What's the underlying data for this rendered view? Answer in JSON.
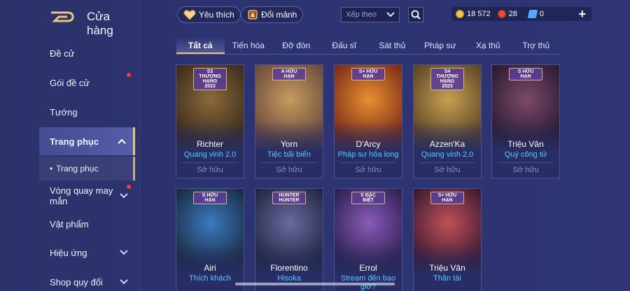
{
  "header": {
    "title": "Cửa hàng",
    "favorite_label": "Yêu thích",
    "exchange_label": "Đổi mảnh",
    "sort_label": "Xếp theo",
    "currencies": [
      {
        "icon": "gold-coin-icon",
        "value": "18 572",
        "color": "#f0c24a"
      },
      {
        "icon": "red-voucher-icon",
        "value": "28",
        "color": "#e0503a"
      },
      {
        "icon": "blue-ticket-icon",
        "value": "0",
        "color": "#5aa7ff"
      }
    ],
    "plus_label": "+"
  },
  "sidebar": {
    "items": [
      {
        "label": "Đề cử",
        "has_dot": false
      },
      {
        "label": "Gói đề cử",
        "has_dot": true
      },
      {
        "label": "Tướng",
        "has_dot": false
      },
      {
        "label": "Trang phục",
        "has_dot": false,
        "expanded": true
      },
      {
        "label": "Trang phục",
        "sub": true
      },
      {
        "label": "Vòng quay may mắn",
        "has_dot": true
      },
      {
        "label": "Vật phẩm",
        "has_dot": false
      },
      {
        "label": "Hiệu ứng",
        "has_dot": false
      },
      {
        "label": "Shop quy đổi",
        "has_dot": false
      }
    ]
  },
  "tabs": [
    "Tất cả",
    "Tiến hóa",
    "Đỡ đòn",
    "Đấu sĩ",
    "Sát thủ",
    "Pháp sư",
    "Xạ thủ",
    "Trợ thủ"
  ],
  "active_tab": 0,
  "cards": [
    {
      "hero": "Richter",
      "skin": "Quang vinh 2.0",
      "status": "Sở hữu",
      "badge": "S3 THƯỢNG HẠNG 2023",
      "c1": "#8a6a3a",
      "c2": "#3c2a1c"
    },
    {
      "hero": "Yorn",
      "skin": "Tiệc bãi biển",
      "status": "Sở hữu",
      "badge": "A HỮU HẠN",
      "c1": "#c69a60",
      "c2": "#6a4a3a"
    },
    {
      "hero": "D'Arcy",
      "skin": "Pháp sư hỏa long",
      "status": "Sở hữu",
      "badge": "S+ HỮU HẠN",
      "c1": "#e8902e",
      "c2": "#7a2a1a"
    },
    {
      "hero": "Azzen'Ka",
      "skin": "Quang vinh 2.0",
      "status": "Sở hữu",
      "badge": "S4 THƯỢNG HẠNG 2023",
      "c1": "#c8a050",
      "c2": "#5a4426"
    },
    {
      "hero": "Triệu Vân",
      "skin": "Quý công tử",
      "status": "Sở hữu",
      "badge": "S HỮU HẠN",
      "c1": "#7a4a6a",
      "c2": "#2a1a30"
    },
    {
      "hero": "Airi",
      "skin": "Thích khách",
      "status": "",
      "badge": "S HỮU HẠN",
      "c1": "#3a7ac0",
      "c2": "#1a2a40"
    },
    {
      "hero": "Florentino",
      "skin": "Hisoka",
      "status": "",
      "badge": "HUNTER HUNTER",
      "c1": "#6a6aa0",
      "c2": "#20263e"
    },
    {
      "hero": "Errol",
      "skin": "Stream đến bao giờ?",
      "status": "",
      "badge": "S ĐẶC BIỆT",
      "c1": "#8a5ab8",
      "c2": "#2a2050"
    },
    {
      "hero": "Triệu Vân",
      "skin": "Thần tài",
      "status": "",
      "badge": "S+ HỮU HẠN",
      "c1": "#c0505a",
      "c2": "#3a1a30"
    }
  ]
}
